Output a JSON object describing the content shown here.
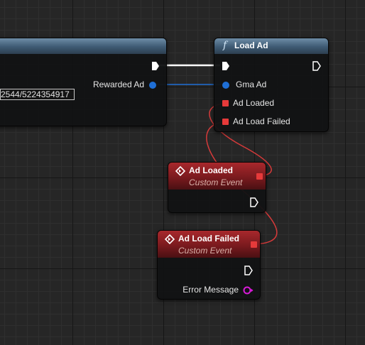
{
  "colors": {
    "function_header": "#4d6b85",
    "event_header": "#8e1f23",
    "exec_wire": "#ffffff",
    "object_wire": "#1f6fd6",
    "delegate_wire": "#d63a3a",
    "string_pin": "#d91ad9"
  },
  "left_node": {
    "output_label": "Rewarded Ad",
    "input_value": "2544/5224354917"
  },
  "load_ad_node": {
    "icon": "function-icon",
    "icon_glyph": "f",
    "title": "Load Ad",
    "pins": {
      "gma_ad": "Gma Ad",
      "ad_loaded": "Ad Loaded",
      "ad_load_failed": "Ad Load Failed"
    }
  },
  "ad_loaded_event": {
    "icon": "event-icon",
    "title": "Ad Loaded",
    "subtitle": "Custom Event"
  },
  "ad_load_failed_event": {
    "icon": "event-icon",
    "title": "Ad Load Failed",
    "subtitle": "Custom Event",
    "pins": {
      "error_message": "Error Message"
    }
  }
}
